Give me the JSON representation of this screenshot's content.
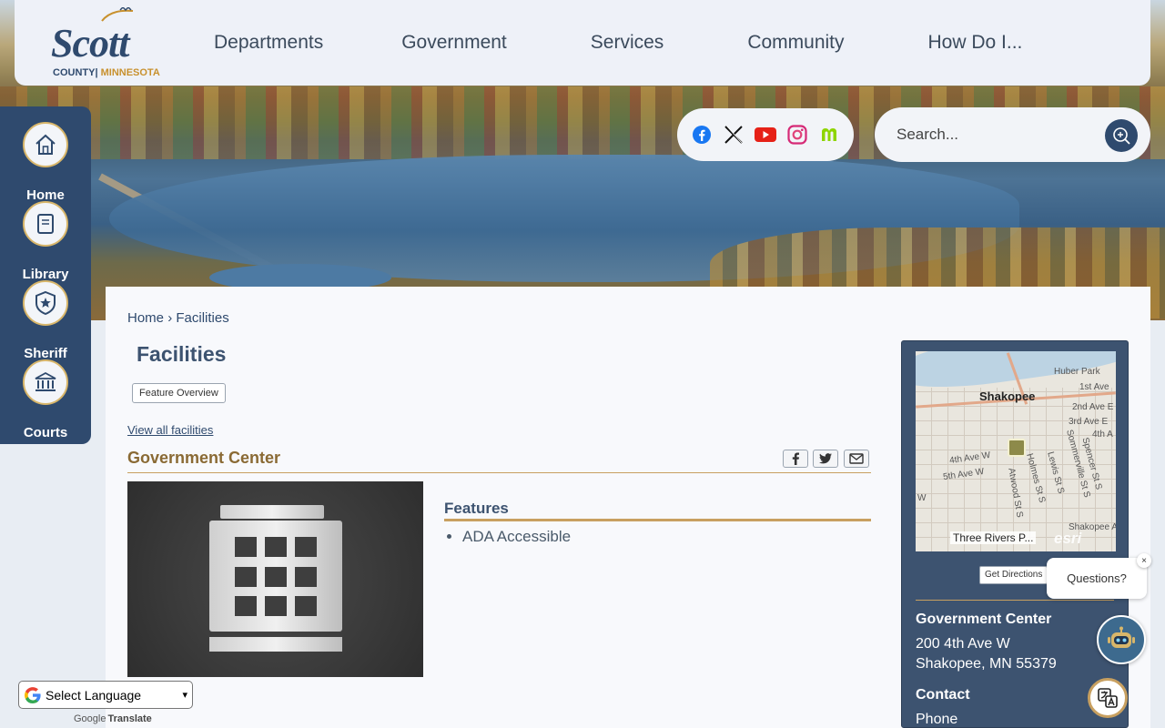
{
  "header": {
    "logo": {
      "name": "Scott",
      "county": "COUNTY",
      "separator": "|",
      "state": "MINNESOTA"
    },
    "nav": [
      "Departments",
      "Government",
      "Services",
      "Community",
      "How Do I..."
    ]
  },
  "social": {
    "icons": [
      "facebook-icon",
      "x-icon",
      "youtube-icon",
      "instagram-icon",
      "nextdoor-icon"
    ],
    "colors": {
      "facebook": "#1877f2",
      "youtube": "#e62117",
      "instagram": "#d62976",
      "nextdoor": "#8ed500"
    }
  },
  "search": {
    "placeholder": "Search..."
  },
  "sidenav": {
    "items": [
      {
        "label": "Home",
        "icon": "house-icon"
      },
      {
        "label": "Library",
        "icon": "book-icon"
      },
      {
        "label": "Sheriff",
        "icon": "badge-icon"
      },
      {
        "label": "Courts",
        "icon": "courthouse-icon"
      }
    ]
  },
  "breadcrumb": {
    "home": "Home",
    "separator": "›",
    "current": "Facilities"
  },
  "page": {
    "title": "Facilities",
    "feature_overview": "Feature Overview",
    "view_all": "View all facilities",
    "facility_name": "Government Center",
    "share": [
      "facebook-share-icon",
      "twitter-share-icon",
      "email-share-icon"
    ]
  },
  "features": {
    "heading": "Features",
    "items": [
      "ADA Accessible"
    ]
  },
  "map": {
    "city": "Shakopee",
    "labels": [
      "Huber Park",
      "1st Ave",
      "2nd Ave E",
      "3rd Ave E",
      "4th A",
      "4th Ave W",
      "5th Ave W",
      "Atwood St S",
      "Holmes St S",
      "Lewis St S",
      "Sommerville St S",
      "Spencer St S",
      "Shakopee A",
      "W"
    ],
    "place": "Three Rivers P...",
    "attribution": "esri"
  },
  "card": {
    "directions": "Get Directions",
    "name": "Government Center",
    "address1": "200 4th Ave W",
    "address2": "Shakopee, MN 55379",
    "contact_heading": "Contact",
    "phone_label": "Phone"
  },
  "chat": {
    "prompt": "Questions?",
    "close": "×"
  },
  "translate": {
    "select": "Select Language",
    "powered_by": "Translate",
    "google": "Google"
  },
  "colors": {
    "navy": "#2f4a6e",
    "gold": "#c8a060",
    "card": "#3d5370"
  }
}
